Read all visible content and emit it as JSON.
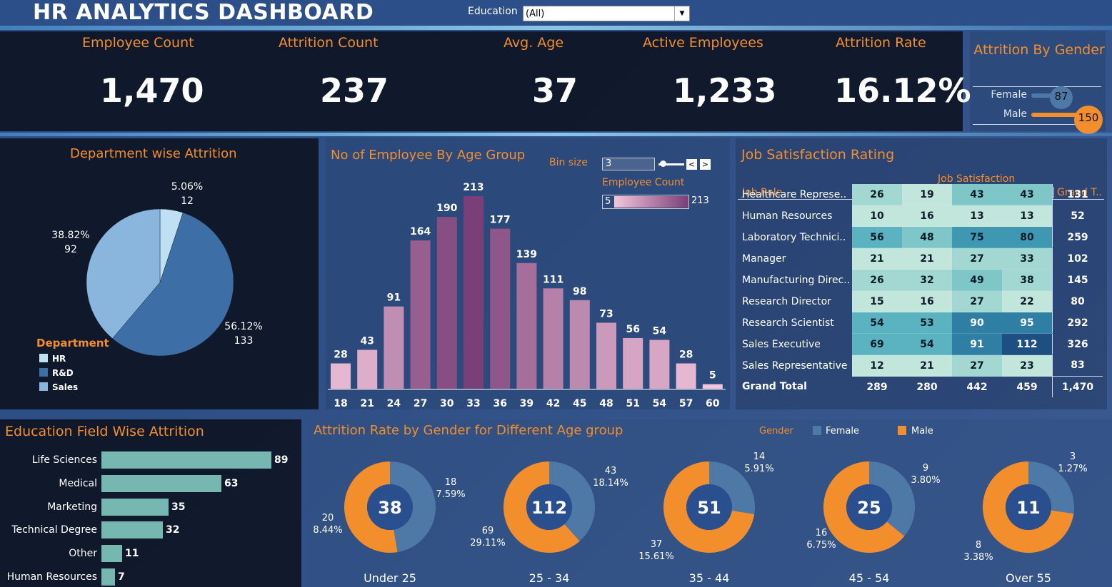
{
  "header": {
    "title": "HR ANALYTICS DASHBOARD",
    "filter_label": "Education",
    "filter_value": "(All)"
  },
  "kpis": [
    {
      "label": "Employee Count",
      "value": "1,470"
    },
    {
      "label": "Attrition Count",
      "value": "237"
    },
    {
      "label": "Avg. Age",
      "value": "37"
    },
    {
      "label": "Active Employees",
      "value": "1,233"
    },
    {
      "label": "Attrition Rate",
      "value": "16.12%"
    }
  ],
  "gender_attrition": {
    "title": "Attrition By Gender",
    "rows": [
      {
        "label": "Female",
        "value": 87
      },
      {
        "label": "Male",
        "value": 150
      }
    ],
    "colors": {
      "female": "#4e79a7",
      "male": "#f28e2b"
    }
  },
  "department": {
    "title": "Department wise Attrition",
    "legend_title": "Department",
    "chart_data": {
      "type": "pie",
      "labels": [
        "HR",
        "R&D",
        "Sales"
      ],
      "values": [
        12,
        133,
        92
      ],
      "percents": [
        "5.06%",
        "56.12%",
        "38.82%"
      ],
      "colors": [
        "#bfe0f2",
        "#3d6ea6",
        "#8ab6dd"
      ]
    }
  },
  "age_group": {
    "title": "No of Employee By Age Group",
    "bin_label": "Bin size",
    "bin_value": "3",
    "legend_title": "Employee Count",
    "legend_min": "5",
    "legend_max": "213",
    "chart_data": {
      "type": "bar",
      "categories": [
        "18",
        "21",
        "24",
        "27",
        "30",
        "33",
        "36",
        "39",
        "42",
        "45",
        "48",
        "51",
        "54",
        "57",
        "60"
      ],
      "values": [
        28,
        43,
        91,
        164,
        190,
        213,
        177,
        139,
        111,
        98,
        73,
        56,
        54,
        28,
        5
      ],
      "ylim": [
        0,
        213
      ]
    }
  },
  "job_satisfaction": {
    "title": "Job Satisfaction Rating",
    "col_group": "Job Satisfaction",
    "row_header": "Job Role",
    "columns": [
      "1",
      "2",
      "3",
      "4",
      "Grand T.."
    ],
    "rows": [
      {
        "role": "Healthcare Represe..",
        "vals": [
          26,
          19,
          43,
          43
        ],
        "total": "131"
      },
      {
        "role": "Human Resources",
        "vals": [
          10,
          16,
          13,
          13
        ],
        "total": "52"
      },
      {
        "role": "Laboratory Technici..",
        "vals": [
          56,
          48,
          75,
          80
        ],
        "total": "259"
      },
      {
        "role": "Manager",
        "vals": [
          21,
          21,
          27,
          33
        ],
        "total": "102"
      },
      {
        "role": "Manufacturing Direc..",
        "vals": [
          26,
          32,
          49,
          38
        ],
        "total": "145"
      },
      {
        "role": "Research Director",
        "vals": [
          15,
          16,
          27,
          22
        ],
        "total": "80"
      },
      {
        "role": "Research Scientist",
        "vals": [
          54,
          53,
          90,
          95
        ],
        "total": "292"
      },
      {
        "role": "Sales Executive",
        "vals": [
          69,
          54,
          91,
          112
        ],
        "total": "326"
      },
      {
        "role": "Sales Representative",
        "vals": [
          12,
          21,
          27,
          23
        ],
        "total": "83"
      }
    ],
    "grand_total": {
      "label": "Grand Total",
      "vals": [
        "289",
        "280",
        "442",
        "459"
      ],
      "total": "1,470"
    }
  },
  "education_field": {
    "title": "Education Field Wise Attrition",
    "chart_data": {
      "type": "bar",
      "categories": [
        "Life Sciences",
        "Medical",
        "Marketing",
        "Technical Degree",
        "Other",
        "Human Resources"
      ],
      "values": [
        89,
        63,
        35,
        32,
        11,
        7
      ],
      "color": "#76b7b2"
    }
  },
  "gender_age": {
    "title": "Attrition Rate by Gender for Different Age group",
    "legend_title": "Gender",
    "legend_female": "Female",
    "legend_male": "Male",
    "chart_data": {
      "type": "pie",
      "groups": [
        {
          "name": "Under 25",
          "total": "38",
          "female": 18,
          "female_pct": "7.59%",
          "male": 20,
          "male_pct": "8.44%"
        },
        {
          "name": "25 - 34",
          "total": "112",
          "female": 43,
          "female_pct": "18.14%",
          "male": 69,
          "male_pct": "29.11%"
        },
        {
          "name": "35 - 44",
          "total": "51",
          "female": 14,
          "female_pct": "5.91%",
          "male": 37,
          "male_pct": "15.61%"
        },
        {
          "name": "45 - 54",
          "total": "25",
          "female": 9,
          "female_pct": "3.80%",
          "male": 16,
          "male_pct": "6.75%"
        },
        {
          "name": "Over 55",
          "total": "11",
          "female": 3,
          "female_pct": "1.27%",
          "male": 8,
          "male_pct": "3.38%"
        }
      ]
    }
  }
}
